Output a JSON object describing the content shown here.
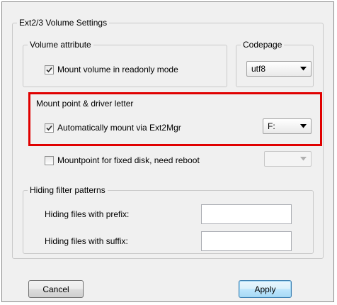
{
  "dialog": {
    "group_title": "Ext2/3 Volume Settings",
    "volume_attribute": {
      "legend": "Volume attribute",
      "readonly_label": "Mount volume in readonly mode",
      "readonly_checked": true
    },
    "codepage": {
      "legend": "Codepage",
      "value": "utf8"
    },
    "mount_point": {
      "legend": "Mount point & driver letter",
      "auto_mount_label": "Automatically mount via Ext2Mgr",
      "auto_mount_checked": true,
      "drive_letter": "F:"
    },
    "fixed_disk": {
      "label": "Mountpoint for fixed disk, need reboot",
      "checked": false,
      "value": ""
    },
    "hiding": {
      "legend": "Hiding filter patterns",
      "prefix_label": "Hiding files with prefix:",
      "prefix_value": "",
      "suffix_label": "Hiding files with suffix:",
      "suffix_value": ""
    },
    "buttons": {
      "cancel": "Cancel",
      "apply": "Apply"
    }
  },
  "colors": {
    "highlight": "#e00000",
    "dialog_bg": "#f0f0f0"
  }
}
